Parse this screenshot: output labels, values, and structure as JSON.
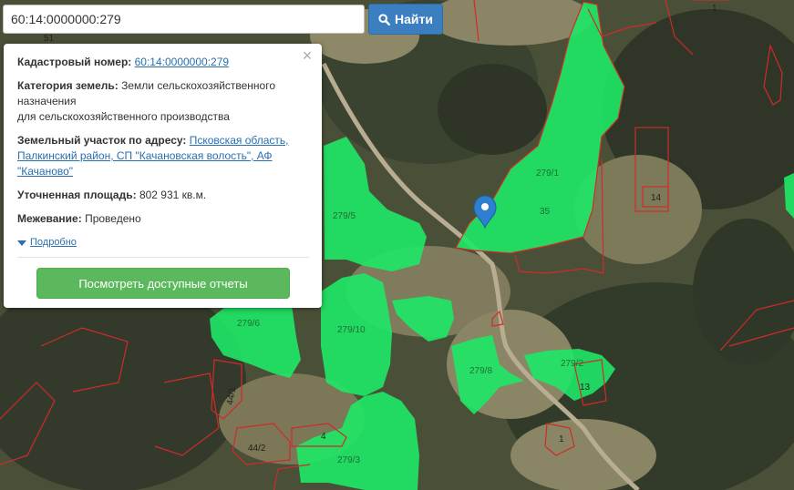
{
  "search": {
    "value": "60:14:0000000:279",
    "button_label": "Найти"
  },
  "popup": {
    "cadastral_label": "Кадастровый номер:",
    "cadastral_value": "60:14:0000000:279",
    "category_label": "Категория земель:",
    "category_value_1": "Земли сельскохозяйственного назначения",
    "category_value_2": "для сельскохозяйственного производства",
    "address_label": "Земельный участок по адресу:",
    "address_value": "Псковская область, Палкинский район, СП \"Качановская волость\", АФ \"Качаново\"",
    "area_label": "Уточненная площадь:",
    "area_value": "802 931 кв.м.",
    "survey_label": "Межевание:",
    "survey_value": "Проведено",
    "details_label": "Подробно",
    "reports_button": "Посмотреть доступные отчеты"
  },
  "map": {
    "parcel_labels": [
      "279/1",
      "35",
      "279/5",
      "279/6",
      "279/10",
      "279/8",
      "279/2",
      "279/3",
      "44/1",
      "44/2",
      "4",
      "14",
      "13",
      "1",
      "1",
      "51"
    ],
    "colors": {
      "parcel_fill": "#1ee866",
      "boundary": "#d12a2a",
      "marker": "#2f7fd1"
    }
  }
}
